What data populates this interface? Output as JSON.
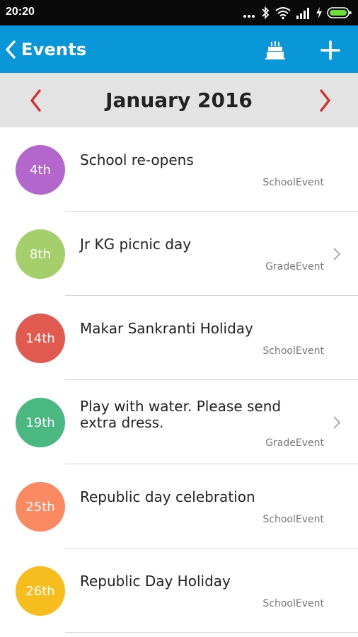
{
  "status": {
    "time": "20:20"
  },
  "header": {
    "back_label": "Events"
  },
  "calendar": {
    "month_label": "January 2016"
  },
  "events": [
    {
      "day": "4th",
      "title": "School re-opens",
      "type": "SchoolEvent",
      "color": "#b366cc",
      "has_arrow": false
    },
    {
      "day": "8th",
      "title": "Jr KG picnic day",
      "type": "GradeEvent",
      "color": "#a5cf6b",
      "has_arrow": true
    },
    {
      "day": "14th",
      "title": "Makar Sankranti Holiday",
      "type": "SchoolEvent",
      "color": "#e05a50",
      "has_arrow": false
    },
    {
      "day": "19th",
      "title": "Play with water. Please send extra dress.",
      "type": "GradeEvent",
      "color": "#4cb881",
      "has_arrow": true
    },
    {
      "day": "25th",
      "title": "Republic day celebration",
      "type": "SchoolEvent",
      "color": "#fb8a62",
      "has_arrow": false
    },
    {
      "day": "26th",
      "title": "Republic Day Holiday",
      "type": "SchoolEvent",
      "color": "#f7bc1e",
      "has_arrow": false
    }
  ],
  "colors": {
    "appbar": "#0a97d9",
    "nav_arrows": "#d32f2f"
  },
  "icons": {
    "back": "chevron-left-icon",
    "cake": "birthday-cake-icon",
    "add": "plus-icon",
    "prev": "chevron-left-icon",
    "next": "chevron-right-icon",
    "row_arrow": "chevron-right-icon"
  }
}
